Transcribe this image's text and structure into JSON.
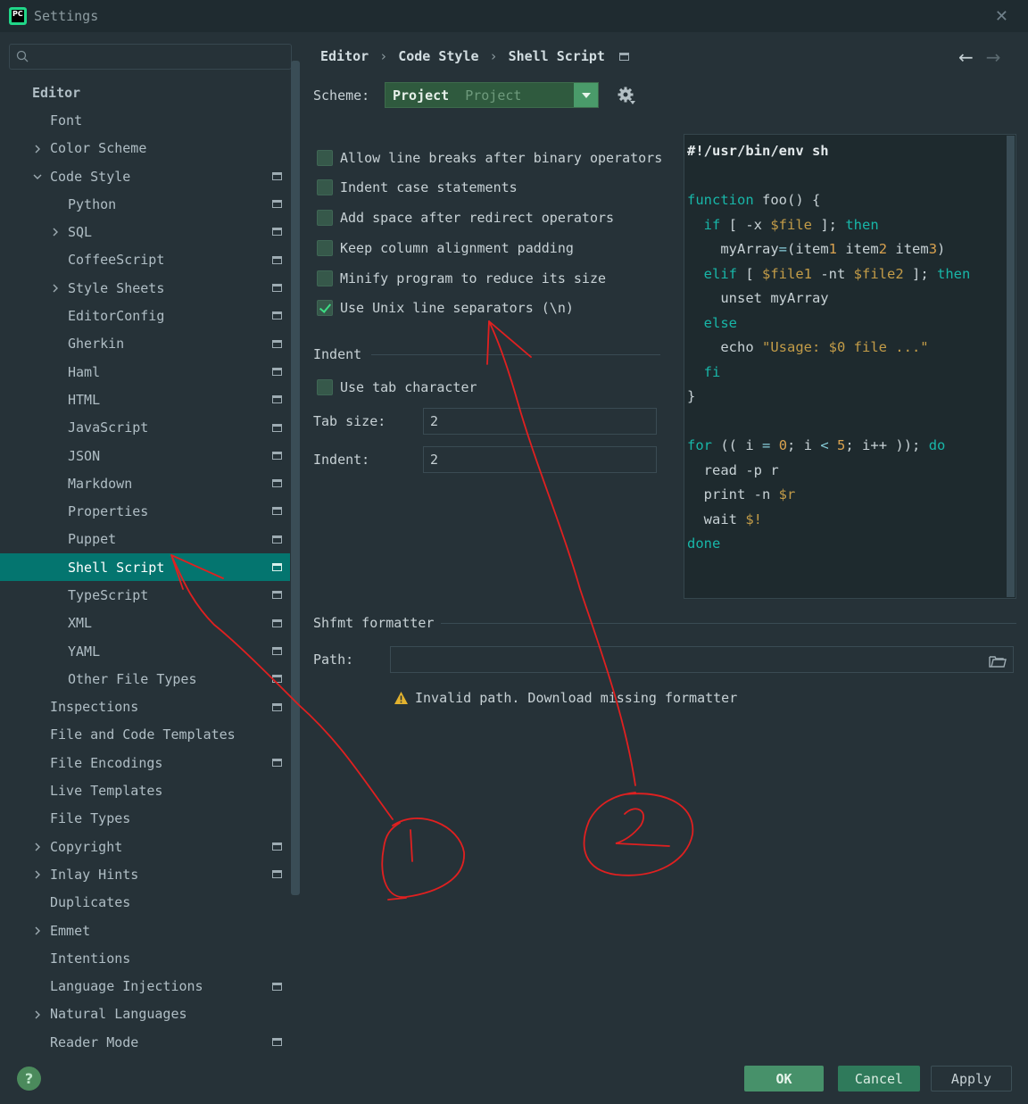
{
  "window": {
    "title": "Settings",
    "app_icon_text": "PC"
  },
  "search": {
    "placeholder": ""
  },
  "sidebar": {
    "items": [
      {
        "label": "Editor",
        "level": 0,
        "bold": true
      },
      {
        "label": "Font",
        "level": 1
      },
      {
        "label": "Color Scheme",
        "level": 1,
        "chevron": "right"
      },
      {
        "label": "Code Style",
        "level": 1,
        "chevron": "down",
        "proj": true
      },
      {
        "label": "Python",
        "level": 2,
        "proj": true
      },
      {
        "label": "SQL",
        "level": 2,
        "chevron": "right",
        "proj": true
      },
      {
        "label": "CoffeeScript",
        "level": 2,
        "proj": true
      },
      {
        "label": "Style Sheets",
        "level": 2,
        "chevron": "right",
        "proj": true
      },
      {
        "label": "EditorConfig",
        "level": 2,
        "proj": true
      },
      {
        "label": "Gherkin",
        "level": 2,
        "proj": true
      },
      {
        "label": "Haml",
        "level": 2,
        "proj": true
      },
      {
        "label": "HTML",
        "level": 2,
        "proj": true
      },
      {
        "label": "JavaScript",
        "level": 2,
        "proj": true
      },
      {
        "label": "JSON",
        "level": 2,
        "proj": true
      },
      {
        "label": "Markdown",
        "level": 2,
        "proj": true
      },
      {
        "label": "Properties",
        "level": 2,
        "proj": true
      },
      {
        "label": "Puppet",
        "level": 2,
        "proj": true
      },
      {
        "label": "Shell Script",
        "level": 2,
        "proj": true,
        "selected": true
      },
      {
        "label": "TypeScript",
        "level": 2,
        "proj": true
      },
      {
        "label": "XML",
        "level": 2,
        "proj": true
      },
      {
        "label": "YAML",
        "level": 2,
        "proj": true
      },
      {
        "label": "Other File Types",
        "level": 2,
        "proj": true
      },
      {
        "label": "Inspections",
        "level": 1,
        "proj": true
      },
      {
        "label": "File and Code Templates",
        "level": 1
      },
      {
        "label": "File Encodings",
        "level": 1,
        "proj": true
      },
      {
        "label": "Live Templates",
        "level": 1
      },
      {
        "label": "File Types",
        "level": 1
      },
      {
        "label": "Copyright",
        "level": 1,
        "chevron": "right",
        "proj": true
      },
      {
        "label": "Inlay Hints",
        "level": 1,
        "chevron": "right",
        "proj": true
      },
      {
        "label": "Duplicates",
        "level": 1
      },
      {
        "label": "Emmet",
        "level": 1,
        "chevron": "right"
      },
      {
        "label": "Intentions",
        "level": 1
      },
      {
        "label": "Language Injections",
        "level": 1,
        "proj": true
      },
      {
        "label": "Natural Languages",
        "level": 1,
        "chevron": "right"
      },
      {
        "label": "Reader Mode",
        "level": 1,
        "proj": true
      }
    ]
  },
  "breadcrumb": {
    "items": [
      "Editor",
      "Code Style",
      "Shell Script"
    ],
    "separator": "›"
  },
  "nav": {
    "back": "←",
    "forward": "→"
  },
  "scheme": {
    "label": "Scheme:",
    "value": "Project",
    "sub": "Project"
  },
  "options": [
    {
      "label": "Allow line breaks after binary operators",
      "checked": false
    },
    {
      "label": "Indent case statements",
      "checked": false
    },
    {
      "label": "Add space after redirect operators",
      "checked": false
    },
    {
      "label": "Keep column alignment padding",
      "checked": false
    },
    {
      "label": "Minify program to reduce its size",
      "checked": false
    },
    {
      "label": "Use Unix line separators (\\n)",
      "checked": true
    }
  ],
  "indent": {
    "section_title": "Indent",
    "use_tab_label": "Use tab character",
    "use_tab_checked": false,
    "tab_size_label": "Tab size:",
    "tab_size_value": "2",
    "indent_label": "Indent:",
    "indent_value": "2"
  },
  "shfmt": {
    "section_title": "Shfmt formatter",
    "path_label": "Path:",
    "path_value": "",
    "warning": "Invalid path. Download missing formatter"
  },
  "preview": {
    "lines": [
      "#!/usr/bin/env sh",
      "",
      "function foo() {",
      "  if [ -x $file ]; then",
      "    myArray=(item1 item2 item3)",
      "  elif [ $file1 -nt $file2 ]; then",
      "    unset myArray",
      "  else",
      "    echo \"Usage: $0 file ...\"",
      "  fi",
      "}",
      "",
      "for (( i = 0; i < 5; i++ )); do",
      "  read -p r",
      "  print -n $r",
      "  wait $!",
      "done"
    ]
  },
  "buttons": {
    "help": "?",
    "ok": "OK",
    "cancel": "Cancel",
    "apply": "Apply"
  },
  "annotations": {
    "circle1": "1",
    "circle2": "2"
  },
  "colors": {
    "accent": "#04756f",
    "background": "#263238",
    "annotation": "#e02020"
  }
}
